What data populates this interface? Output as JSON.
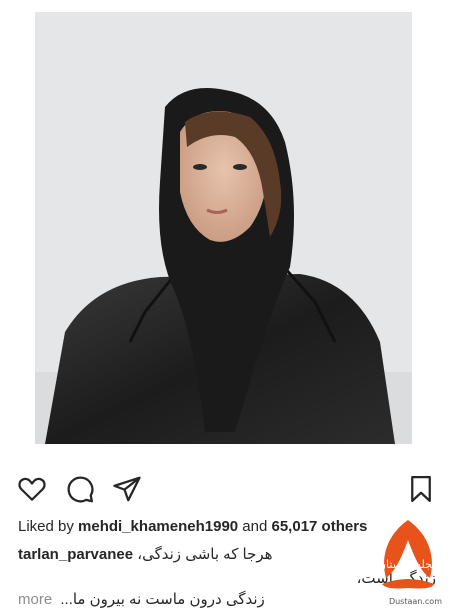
{
  "post": {
    "image_alt": "Portrait of a woman in a black scarf and leather jacket"
  },
  "actions": {
    "like": "heart-icon",
    "comment": "comment-bubble-icon",
    "share": "paper-plane-icon",
    "save": "bookmark-icon"
  },
  "likes": {
    "prefix": "Liked by",
    "user": "mehdi_khameneh1990",
    "conjunction": "and",
    "others": "65,017 others"
  },
  "caption": {
    "username": "tarlan_parvanee",
    "line1": "هرجا که باشی زندگی،",
    "line2": "زندگی است،",
    "line3": "زندگی درون ماست نه بیرون ما...",
    "more": "more"
  },
  "watermark": {
    "logo_text": "مجله دوستان",
    "site": "Dustaan.com"
  },
  "colors": {
    "text": "#262626",
    "muted": "#8e8e8e",
    "watermark_orange": "#e8531c"
  }
}
